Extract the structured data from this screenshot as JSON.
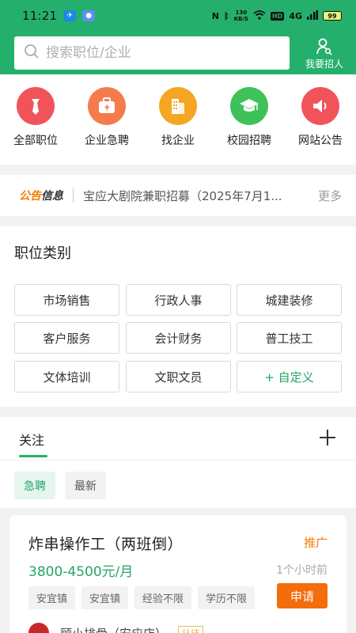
{
  "status_bar": {
    "time": "11:21",
    "speed_value": "130",
    "speed_unit": "KB/S",
    "hd": "HD",
    "signal": "4G",
    "battery": "99"
  },
  "search": {
    "placeholder": "搜索职位/企业"
  },
  "recruit": {
    "label": "我要招人"
  },
  "quick_menu": [
    {
      "label": "全部职位",
      "icon": "tie-icon",
      "color": "#f0545a"
    },
    {
      "label": "企业急聘",
      "icon": "briefcase-lightning-icon",
      "color": "#f57b4d"
    },
    {
      "label": "找企业",
      "icon": "building-icon",
      "color": "#f5a623"
    },
    {
      "label": "校园招聘",
      "icon": "graduation-cap-icon",
      "color": "#3fc15a"
    },
    {
      "label": "网站公告",
      "icon": "speaker-icon",
      "color": "#f0545a"
    }
  ],
  "notice": {
    "tag_a": "公告",
    "tag_b": "信息",
    "text": "宝应大剧院兼职招募（2025年7月1...",
    "more": "更多"
  },
  "categories": {
    "title": "职位类别",
    "items": [
      "市场销售",
      "行政人事",
      "城建装修",
      "客户服务",
      "会计财务",
      "普工技工",
      "文体培训",
      "文职文员"
    ],
    "custom": "+ 自定义"
  },
  "follow": {
    "tab": "关注",
    "filters": [
      "急聘",
      "最新"
    ]
  },
  "job": {
    "title": "炸串操作工（两班倒）",
    "promo": "推广",
    "salary": "3800-4500元/月",
    "ago": "1个小时前",
    "tags": [
      "安宜镇",
      "安宜镇",
      "经验不限",
      "学历不限"
    ],
    "apply": "申请",
    "company": "顾小排骨（安应店）",
    "verify": "认证"
  },
  "colors": {
    "brand_green": "#24b06c",
    "accent_orange": "#f56c0a"
  }
}
